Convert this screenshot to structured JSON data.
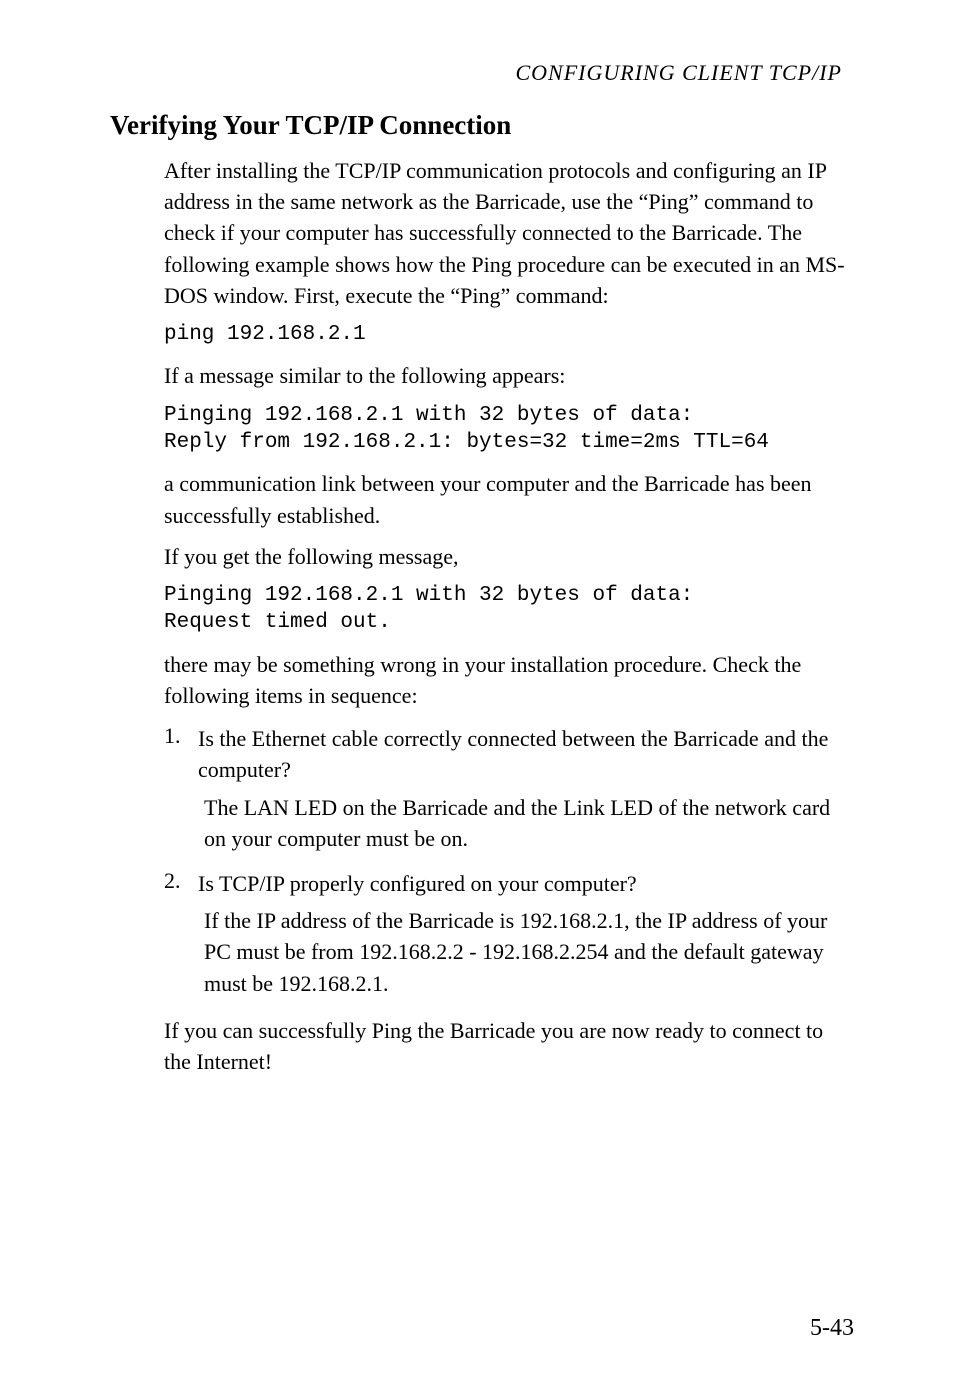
{
  "running_head": "CONFIGURING CLIENT TCP/IP",
  "heading": "Verifying Your TCP/IP Connection",
  "intro": "After installing the TCP/IP communication protocols and configuring an IP address in the same network as the Barricade, use the “Ping” command to check if your computer has successfully connected to the Barricade. The following example shows how the Ping procedure can be executed in an MS-DOS window. First, execute the “Ping” command:",
  "cmd1": "ping 192.168.2.1",
  "similar_lead": "If a message similar to the following appears:",
  "cmd2": "Pinging 192.168.2.1 with 32 bytes of data:\nReply from 192.168.2.1: bytes=32 time=2ms TTL=64",
  "link_established": "a communication link between your computer and the Barricade has been successfully established.",
  "following_msg": "If you get the following message,",
  "cmd3": "Pinging 192.168.2.1 with 32 bytes of data:\nRequest timed out.",
  "something_wrong": "there may be something wrong in your installation procedure. Check the following items in sequence:",
  "steps": [
    {
      "num": "1.",
      "q": "Is the Ethernet cable correctly connected between the Barricade and the computer?",
      "ans": "The LAN LED on the Barricade and the Link LED of the network card on your computer must be on."
    },
    {
      "num": "2.",
      "q": "Is TCP/IP properly configured on your computer?",
      "ans": "If the IP address of the Barricade is 192.168.2.1, the IP address of your PC must be from 192.168.2.2 - 192.168.2.254 and the default gateway must be 192.168.2.1."
    }
  ],
  "closing": "If you can successfully Ping the Barricade you are now ready to connect to the Internet!",
  "page_number": "5-43"
}
